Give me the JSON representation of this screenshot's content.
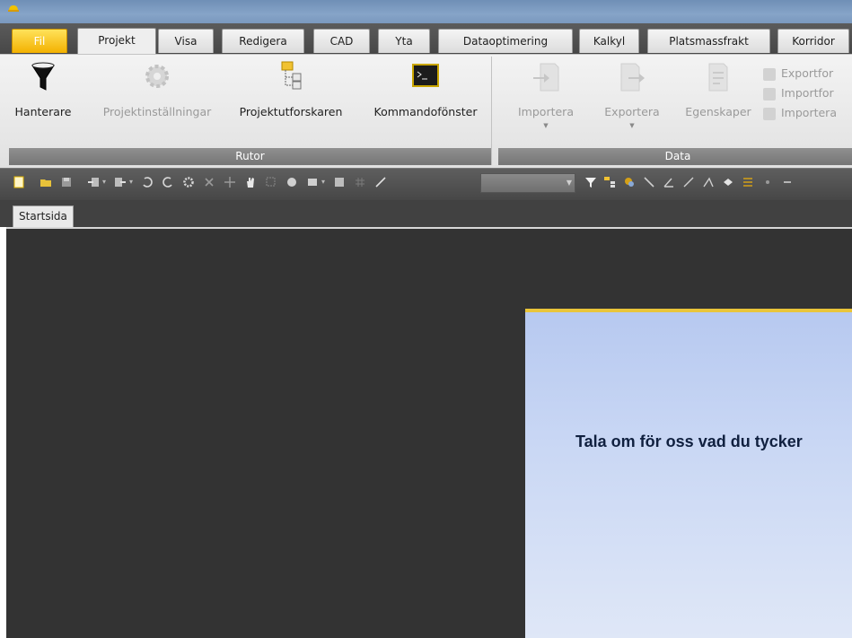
{
  "window": {
    "app_icon": "hardhat-icon"
  },
  "tabs": [
    {
      "label": "Fil"
    },
    {
      "label": "Projekt"
    },
    {
      "label": "Visa"
    },
    {
      "label": "Redigera"
    },
    {
      "label": "CAD"
    },
    {
      "label": "Yta"
    },
    {
      "label": "Dataoptimering"
    },
    {
      "label": "Kalkyl"
    },
    {
      "label": "Platsmassfrakt"
    },
    {
      "label": "Korridor"
    }
  ],
  "active_tab": "Projekt",
  "ribbon": {
    "groups": [
      {
        "label": "Rutor",
        "buttons": [
          {
            "label": "Hanterare",
            "icon": "funnel-icon",
            "enabled": true
          },
          {
            "label": "Projektinställningar",
            "icon": "gear-icon",
            "enabled": false
          },
          {
            "label": "Projektutforskaren",
            "icon": "project-explorer-icon",
            "enabled": true
          },
          {
            "label": "Kommandofönster",
            "icon": "command-window-icon",
            "enabled": true
          }
        ]
      },
      {
        "label": "Data",
        "buttons": [
          {
            "label": "Importera",
            "icon": "import-icon",
            "enabled": false
          },
          {
            "label": "Exportera",
            "icon": "export-icon",
            "enabled": false
          },
          {
            "label": "Egenskaper",
            "icon": "properties-icon",
            "enabled": false
          }
        ],
        "small_items": [
          {
            "label": "Exportfor"
          },
          {
            "label": "Importfor"
          },
          {
            "label": "Importera"
          }
        ]
      }
    ]
  },
  "toolbar": {
    "combo_value": ""
  },
  "document_tabs": [
    {
      "label": "Startsida"
    }
  ],
  "start_page": {
    "feedback_text": "Tala om för oss vad du tycker"
  },
  "colors": {
    "fil_tab": "#f3b100",
    "main_bg": "#333333",
    "accent_strip": "#e9c53a"
  }
}
